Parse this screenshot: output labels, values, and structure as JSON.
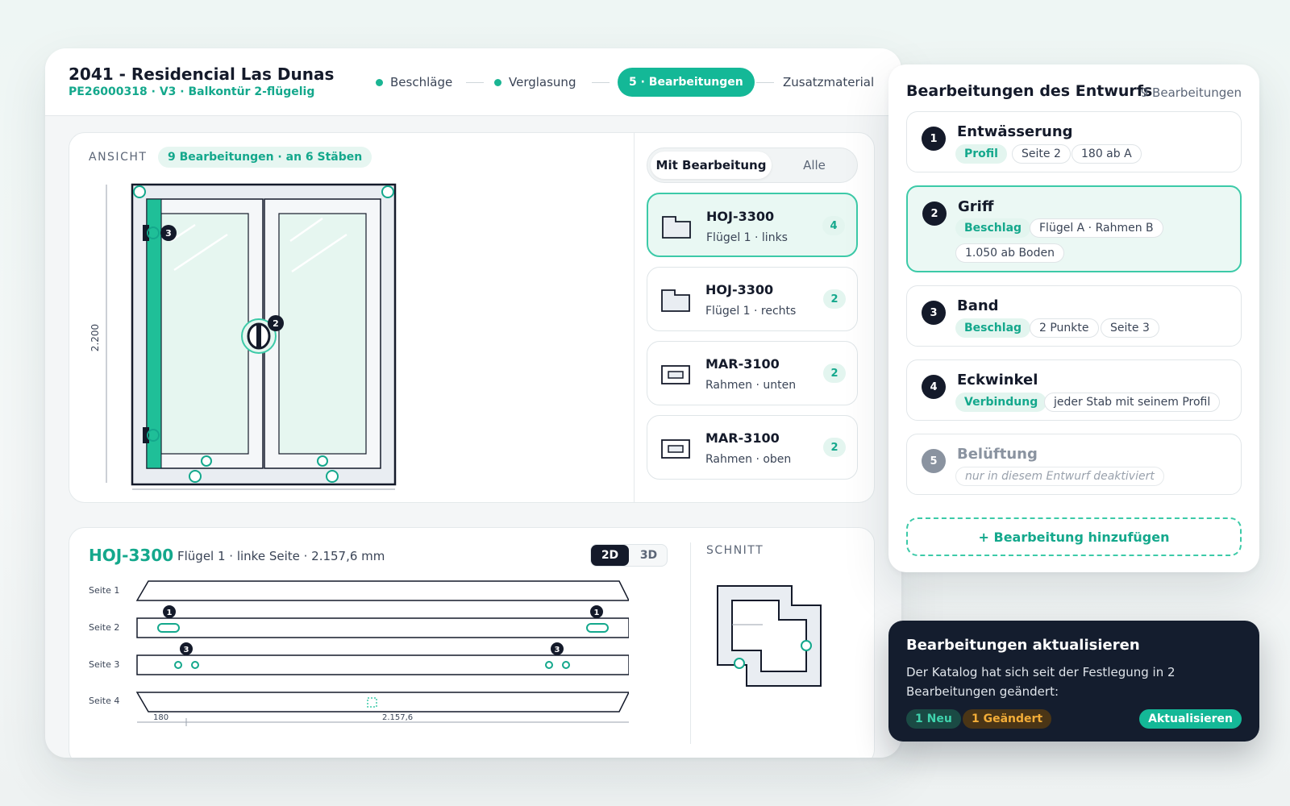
{
  "header": {
    "project_title": "2041 - Residencial Las Dunas",
    "project_sub": "PE26000318 · V3 · Balkontür 2-flügelig",
    "steps": [
      {
        "label": "Beschläge",
        "state": "done"
      },
      {
        "label": "Verglasung",
        "state": "done"
      },
      {
        "label": "5 · Bearbeitungen",
        "state": "active"
      },
      {
        "label": "Zusatzmaterial",
        "state": "upcoming"
      }
    ]
  },
  "ansicht": {
    "label": "ANSICHT",
    "badge": "9 Bearbeitungen · an 6 Stäben",
    "height_dim": "2.200",
    "markers": [
      "3",
      "2"
    ],
    "filter": {
      "active": "Mit Bearbeitung",
      "inactive": "Alle"
    },
    "profiles": [
      {
        "name": "HOJ-3300",
        "sub": "Flügel 1 · links",
        "count": "4",
        "icon": "l-profile-icon",
        "selected": true
      },
      {
        "name": "HOJ-3300",
        "sub": "Flügel 1 · rechts",
        "count": "2",
        "icon": "l-profile-icon",
        "selected": false
      },
      {
        "name": "MAR-3100",
        "sub": "Rahmen · unten",
        "count": "2",
        "icon": "rect-profile-icon",
        "selected": false
      },
      {
        "name": "MAR-3100",
        "sub": "Rahmen · oben",
        "count": "2",
        "icon": "rect-profile-icon",
        "selected": false
      }
    ]
  },
  "detail": {
    "id": "HOJ-3300",
    "desc": "Flügel 1 · linke Seite · 2.157,6 mm",
    "view_2d": "2D",
    "view_3d": "3D",
    "schnitt_label": "SCHNITT",
    "sides": [
      "Seite 1",
      "Seite 2",
      "Seite 3",
      "Seite 4"
    ],
    "side_markers": [
      "1",
      "1",
      "3",
      "3"
    ],
    "dim_start": "180",
    "dim_total": "2.157,6"
  },
  "operations_panel": {
    "title": "Bearbeitungen des Entwurfs",
    "count": "9 Bearbeitungen",
    "items": [
      {
        "num": "1",
        "name": "Entwässerung",
        "tag": "Profil",
        "chips": [
          "Seite 2",
          "180 ab A"
        ]
      },
      {
        "num": "2",
        "name": "Griff",
        "tag": "Beschlag",
        "chips": [
          "Flügel A · Rahmen B",
          "1.050 ab Boden"
        ]
      },
      {
        "num": "3",
        "name": "Band",
        "tag": "Beschlag",
        "chips": [
          "2 Punkte",
          "Seite 3"
        ]
      },
      {
        "num": "4",
        "name": "Eckwinkel",
        "tag": "Verbindung",
        "chips": [
          "jeder Stab mit seinem Profil"
        ]
      },
      {
        "num": "5",
        "name": "Belüftung",
        "tag": "",
        "chips": [
          "nur in diesem Entwurf deaktiviert"
        ]
      }
    ],
    "add_label": "+ Bearbeitung hinzufügen"
  },
  "toast": {
    "title": "Bearbeitungen aktualisieren",
    "body": "Der Katalog hat sich seit der Festlegung in 2 Bearbeitungen geändert:",
    "badge_new": "1 Neu",
    "badge_changed": "1 Geändert",
    "action": "Aktualisieren"
  },
  "colors": {
    "accent": "#14b897",
    "accent_text": "#14a88c",
    "dark": "#141a2a",
    "glass": "#e6f6f0",
    "frame_fill": "#e9edf2",
    "warning": "#f3ad38"
  }
}
